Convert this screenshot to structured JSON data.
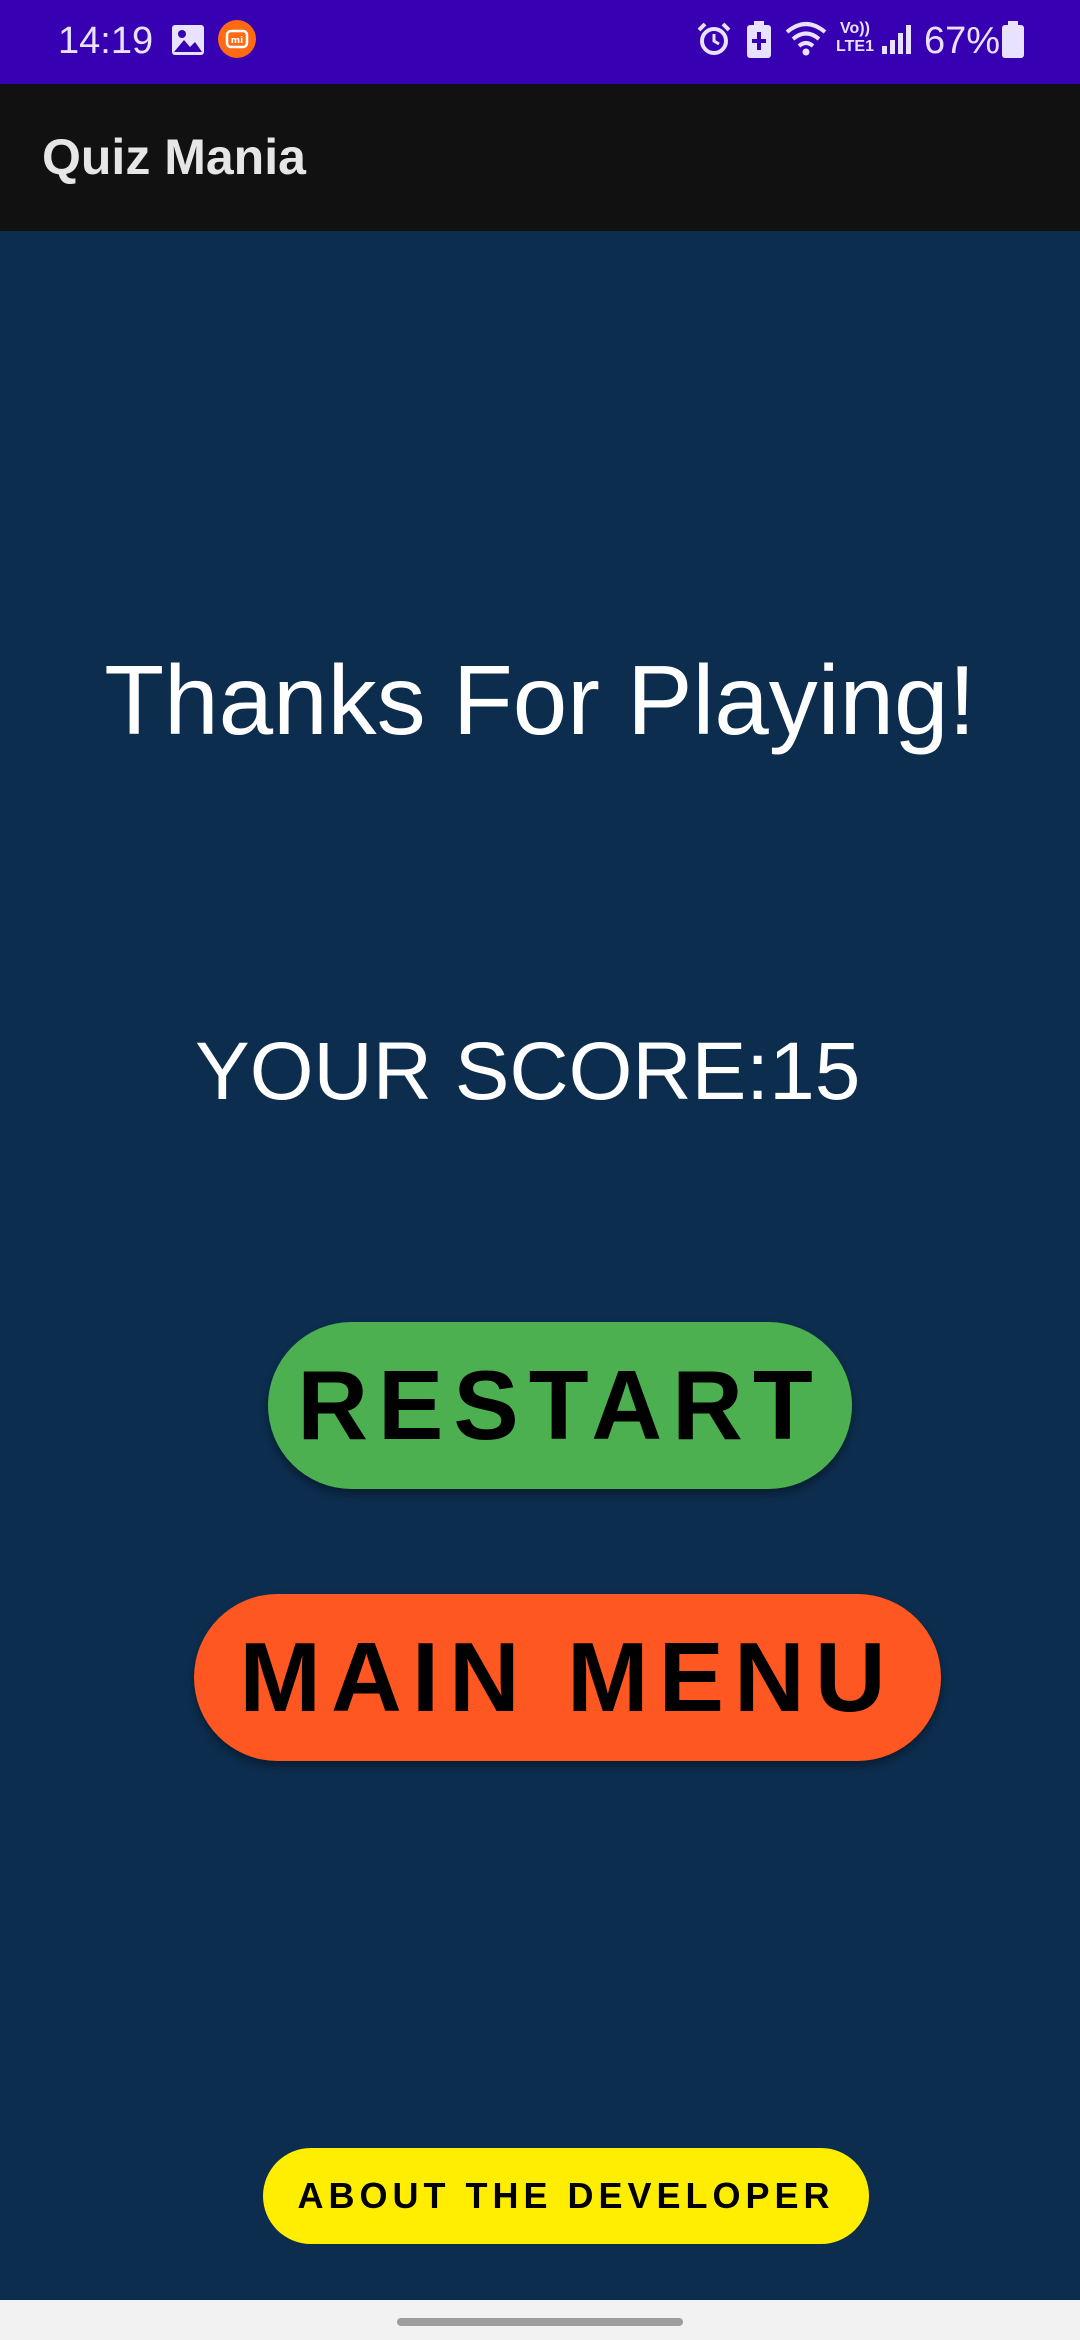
{
  "status_bar": {
    "time": "14:19",
    "battery_percent": "67%",
    "network_label_top": "Vo))",
    "network_label_bottom": "LTE1",
    "icons": [
      "image-icon",
      "mi-app-icon",
      "alarm-icon",
      "battery-saver-icon",
      "wifi-icon",
      "volte-icon",
      "signal-icon",
      "battery-icon"
    ]
  },
  "app_bar": {
    "title": "Quiz Mania"
  },
  "result": {
    "heading": "Thanks For Playing!",
    "score_label": "YOUR SCORE:",
    "score_value": "15"
  },
  "buttons": {
    "restart": "RESTART",
    "main_menu": "MAIN MENU",
    "about": "ABOUT THE DEVELOPER"
  },
  "colors": {
    "status_bar": "#3700b3",
    "app_bar": "#111111",
    "background": "#0c2d4d",
    "restart_button": "#4caf50",
    "main_menu_button": "#ff5722",
    "about_button": "#ffee00"
  }
}
